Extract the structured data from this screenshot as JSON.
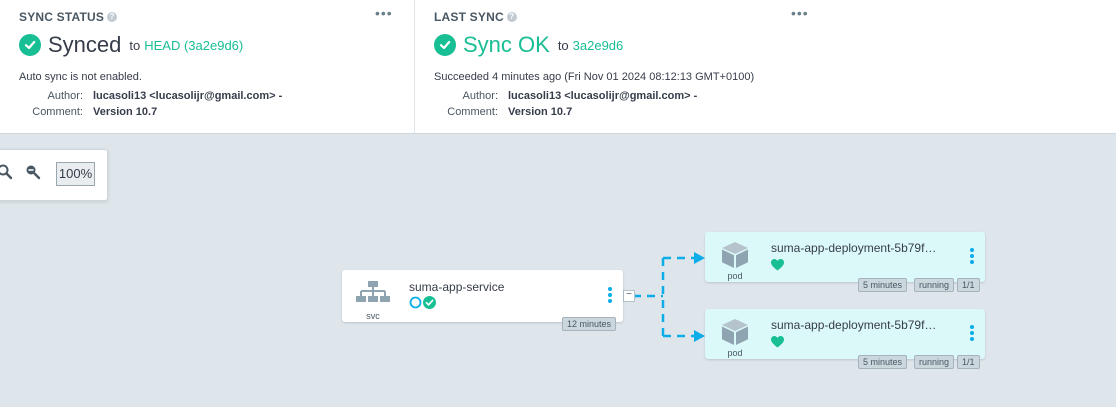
{
  "sync_status": {
    "title": "SYNC STATUS",
    "help": "?",
    "menu": "•••",
    "status": "Synced",
    "to_prefix": "to",
    "revision": "HEAD (3a2e9d6)",
    "message": "Auto sync is not enabled.",
    "author_key": "Author:",
    "author": "lucasoli13 <lucasolijr@gmail.com> -",
    "comment_key": "Comment:",
    "comment": "Version 10.7"
  },
  "last_sync": {
    "title": "LAST SYNC",
    "help": "?",
    "menu": "•••",
    "status": "Sync OK",
    "to_prefix": "to",
    "revision": "3a2e9d6",
    "message": "Succeeded 4 minutes ago (Fri Nov 01 2024 08:12:13 GMT+0100)",
    "author_key": "Author:",
    "author": "lucasoli13 <lucasolijr@gmail.com> -",
    "comment_key": "Comment:",
    "comment": "Version 10.7"
  },
  "zoom": {
    "level": "100%"
  },
  "graph": {
    "collapse_symbol": "−",
    "service": {
      "name": "suma-app-service",
      "kind": "svc",
      "age": "12 minutes"
    },
    "pods": [
      {
        "name": "suma-app-deployment-5b79f…",
        "kind": "pod",
        "age": "5 minutes",
        "status": "running",
        "ready": "1/1"
      },
      {
        "name": "suma-app-deployment-5b79f…",
        "kind": "pod",
        "age": "5 minutes",
        "status": "running",
        "ready": "1/1"
      }
    ]
  },
  "colors": {
    "healthy_green": "#18be94",
    "link_blue": "#0dadea",
    "pod_bg": "#dcf9f9",
    "canvas_bg": "#dee6eb"
  }
}
